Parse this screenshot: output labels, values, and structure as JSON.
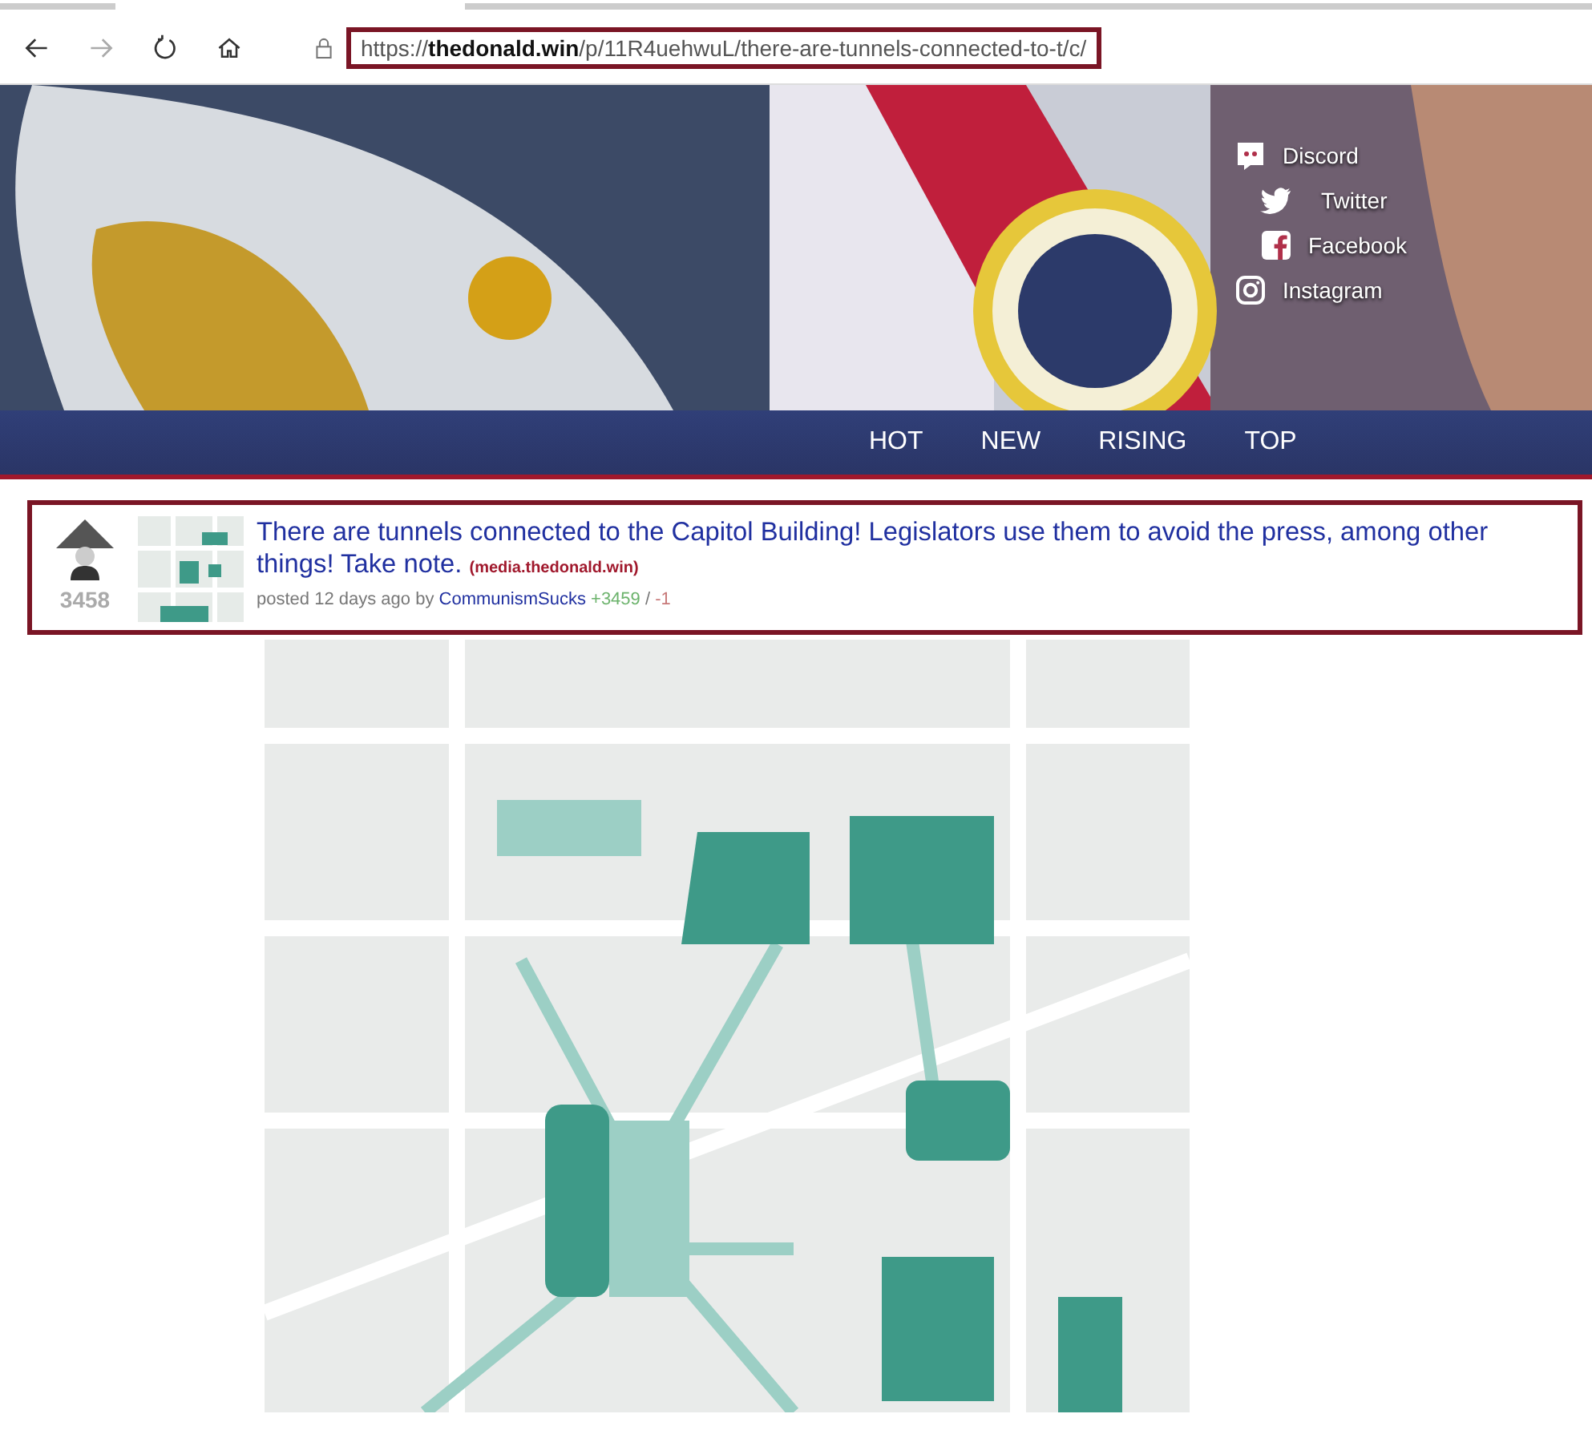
{
  "browser": {
    "url": "https://**thedonald.win**/p/11R4uehwuL/there-are-tunnels-connected-to-t/c/"
  },
  "social_links": [
    {
      "kind": "discord",
      "label": "Discord"
    },
    {
      "kind": "twitter",
      "label": "Twitter"
    },
    {
      "kind": "facebook",
      "label": "Facebook"
    },
    {
      "kind": "instagram",
      "label": "Instagram"
    }
  ],
  "nav": [
    {
      "label": "HOT"
    },
    {
      "label": "NEW"
    },
    {
      "label": "RISING"
    },
    {
      "label": "TOP"
    }
  ],
  "post": {
    "score": "3458",
    "title": "There are tunnels connected to the Capitol Building! Legislators use them to avoid the press, among other things! Take note.",
    "domain": "(media.thedonald.win)",
    "meta": "posted 12 days ago by",
    "author": "CommunismSucks",
    "upvotes": "+3459",
    "separator": "/",
    "downvotes": "-1"
  }
}
